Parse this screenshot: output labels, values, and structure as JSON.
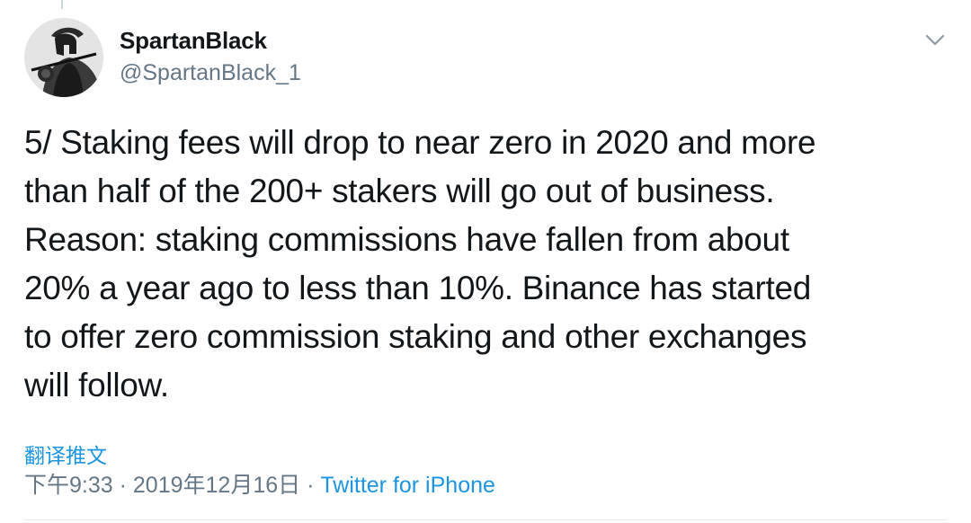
{
  "tweet": {
    "author": {
      "display_name": "SpartanBlack",
      "handle": "@SpartanBlack_1"
    },
    "text_lines": [
      "5/ Staking fees will drop to near zero in 2020 and more",
      "than half of the 200+ stakers will go out of business.",
      "Reason: staking commissions have fallen from about",
      "20% a year ago to less than 10%. Binance has started",
      "to offer zero commission staking and other exchanges",
      "will follow."
    ],
    "translate_label": "翻译推文",
    "time": "下午9:33",
    "separator": "·",
    "date": "2019年12月16日",
    "source": "Twitter for iPhone"
  },
  "icons": {
    "avatar": "spartan-warrior-avatar",
    "menu": "chevron-down-icon"
  },
  "colors": {
    "link": "#1b95e0",
    "muted": "#657786",
    "text": "#14171a"
  }
}
